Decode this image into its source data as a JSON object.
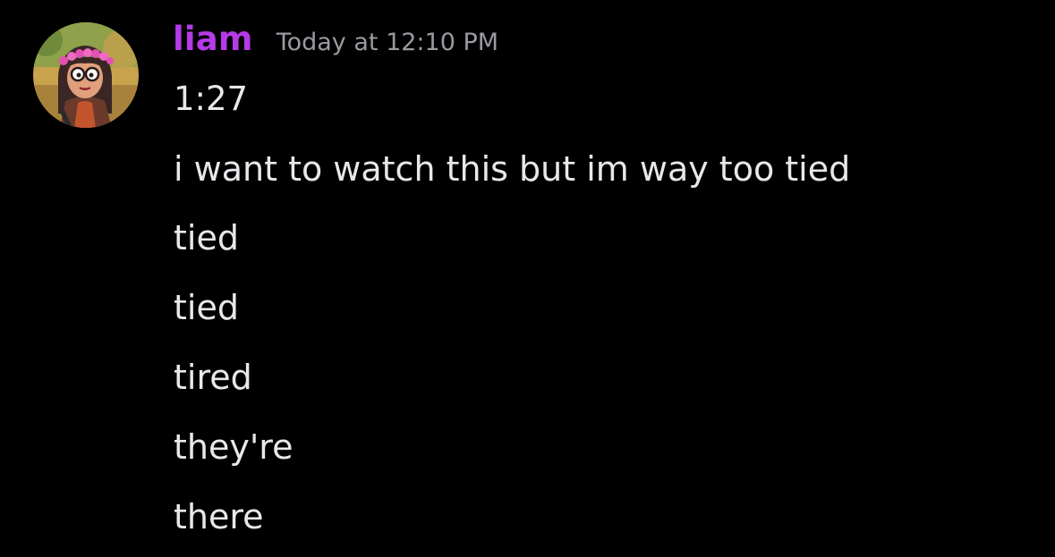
{
  "message": {
    "author": {
      "name": "liam",
      "name_color": "#b43be6",
      "avatar": "avatar-character-with-flower-crown"
    },
    "timestamp": "Today at 12:10 PM",
    "lines": [
      "1:27",
      "i want to watch this but im way too tied",
      "tied",
      "tied",
      "tired",
      "they're",
      "there"
    ]
  },
  "colors": {
    "background": "#000000",
    "text": "#e8e8ec",
    "timestamp": "#9a9aa2",
    "username": "#b43be6"
  }
}
